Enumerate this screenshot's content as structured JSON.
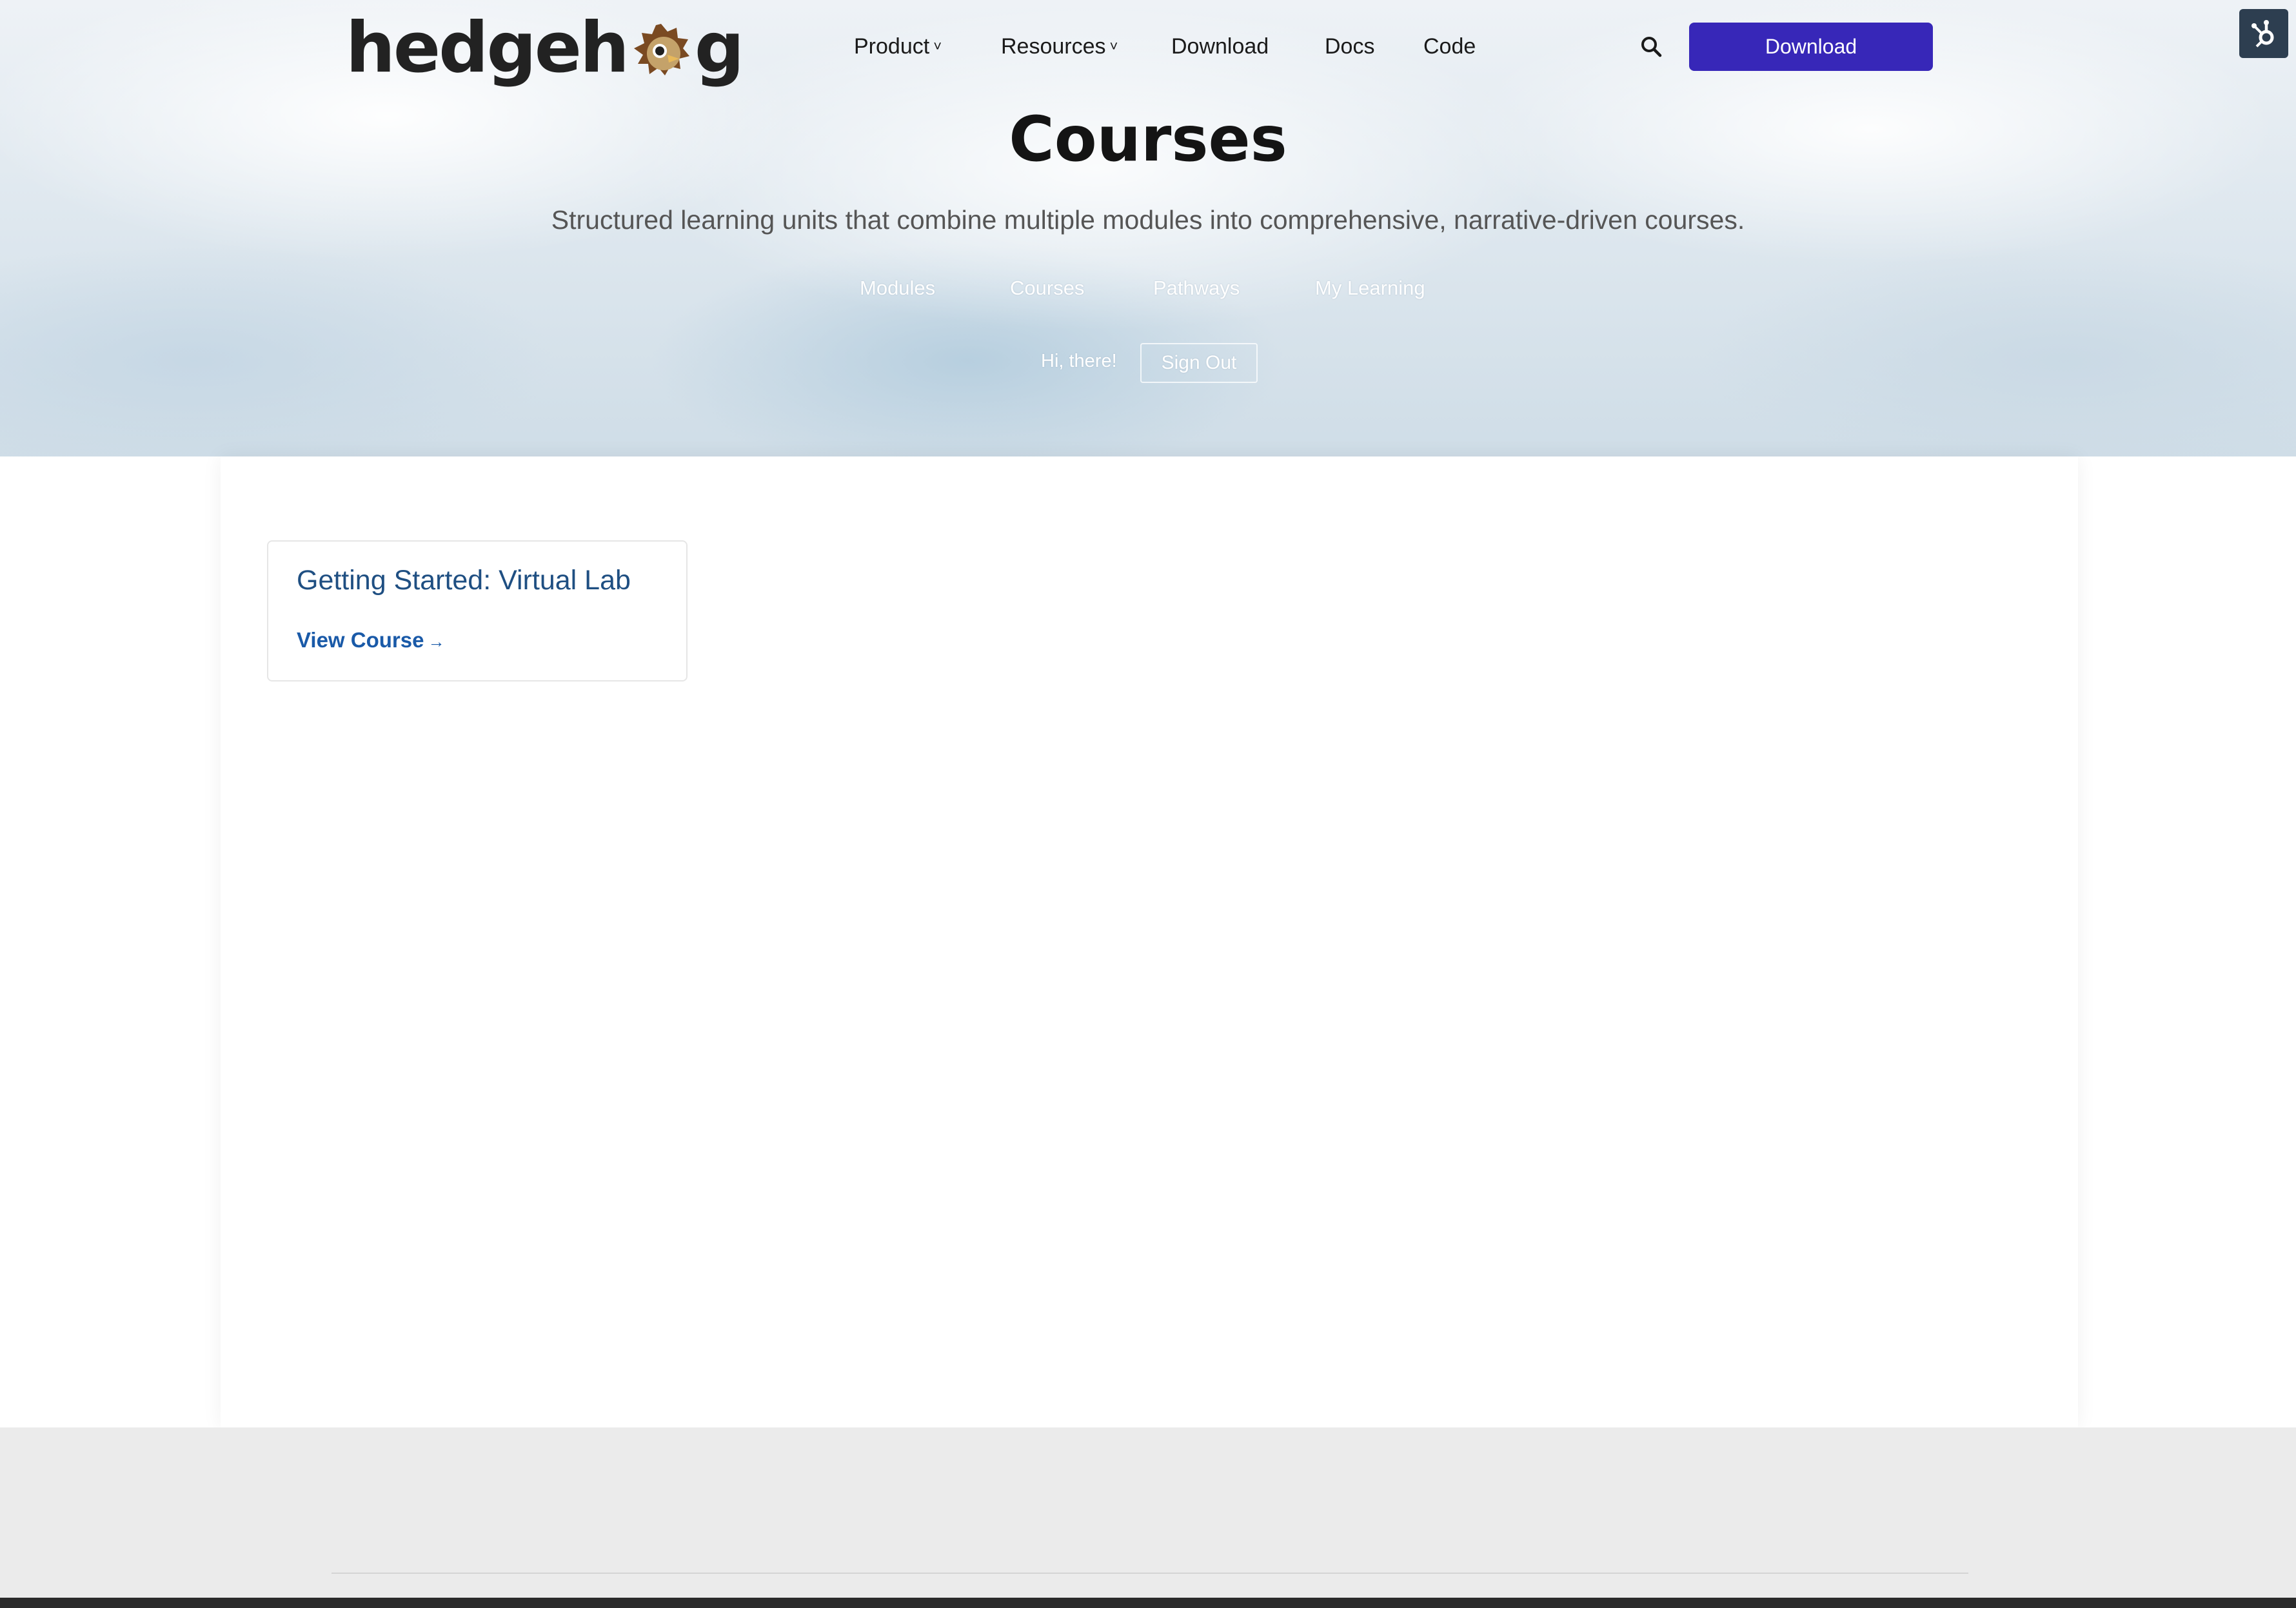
{
  "header": {
    "logo_left": "hedgeh",
    "logo_right": "g",
    "nav": [
      {
        "label": "Product",
        "has_dropdown": true
      },
      {
        "label": "Resources",
        "has_dropdown": true
      },
      {
        "label": "Download",
        "has_dropdown": false
      },
      {
        "label": "Docs",
        "has_dropdown": false
      },
      {
        "label": "Code",
        "has_dropdown": false
      }
    ],
    "dropdown_glyph": "˅",
    "search_icon": "search-icon",
    "cta_label": "Download",
    "cta_color": "#3727b8"
  },
  "hero": {
    "title": "Courses",
    "subtitle": "Structured learning units that combine multiple modules into comprehensive, narrative-driven courses.",
    "tabs": [
      "Modules",
      "Courses",
      "Pathways",
      "My Learning"
    ],
    "greeting": "Hi, there!",
    "sign_out": "Sign Out"
  },
  "courses": [
    {
      "title": "Getting Started: Virtual Lab",
      "link_label": "View Course",
      "link_arrow": "→"
    }
  ],
  "colors": {
    "accent": "#3727b8",
    "course_title": "#1f4f82",
    "course_link": "#1a5aa8",
    "footer_bg": "#ebebeb"
  }
}
